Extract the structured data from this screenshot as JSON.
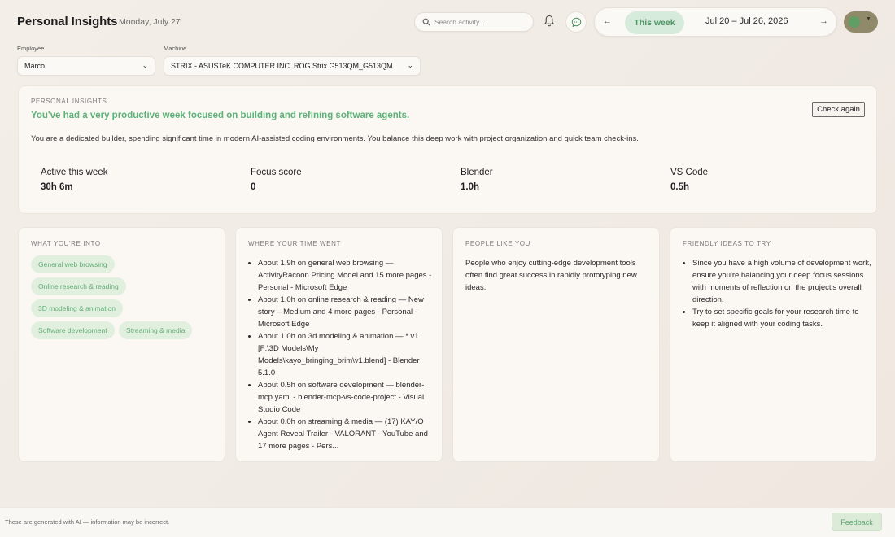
{
  "header": {
    "title": "Personal Insights",
    "date": "Monday, July 27",
    "search_placeholder": "Search activity...",
    "week": {
      "prev": "←",
      "current_label": "This week",
      "range": "Jul 20 – Jul 26, 2026",
      "next": "→"
    }
  },
  "filters": {
    "employee_label": "Employee",
    "employee_value": "Marco",
    "machine_label": "Machine",
    "machine_value": "STRIX - ASUSTeK COMPUTER INC. ROG Strix G513QM_G513QM"
  },
  "insights": {
    "section_label": "PERSONAL INSIGHTS",
    "headline": "You've had a very productive week focused on building and refining software agents.",
    "summary": "You are a dedicated builder, spending significant time in modern AI-assisted coding environments. You balance this deep work with project organization and quick team check-ins.",
    "check_again_label": "Check again",
    "stats": [
      {
        "label": "Active this week",
        "value": "30h 6m"
      },
      {
        "label": "Focus score",
        "value": "0"
      },
      {
        "label": "Blender",
        "value": "1.0h"
      },
      {
        "label": "VS Code",
        "value": "0.5h"
      }
    ]
  },
  "cards": {
    "interests": {
      "title": "WHAT YOU'RE INTO",
      "tags": [
        "General web browsing",
        "Online research & reading",
        "3D modeling & animation",
        "Software development",
        "Streaming & media"
      ]
    },
    "time": {
      "title": "WHERE YOUR TIME WENT",
      "items": [
        "About 1.9h on general web browsing — ActivityRacoon Pricing Model and 15 more pages - Personal - Microsoft Edge",
        "About 1.0h on online research & reading — New story – Medium and 4 more pages - Personal - Microsoft Edge",
        "About 1.0h on 3d modeling & animation — * v1 [F:\\3D Models\\My Models\\kayo_bringing_brim\\v1.blend] - Blender 5.1.0",
        "About 0.5h on software development — blender-mcp.yaml - blender-mcp-vs-code-project - Visual Studio Code",
        "About 0.0h on streaming & media — (17) KAY/O Agent Reveal Trailer - VALORANT - YouTube and 17 more pages - Pers..."
      ]
    },
    "people": {
      "title": "PEOPLE LIKE YOU",
      "body": "People who enjoy cutting-edge development tools often find great success in rapidly prototyping new ideas."
    },
    "ideas": {
      "title": "FRIENDLY IDEAS TO TRY",
      "items": [
        "Since you have a high volume of development work, ensure you're balancing your deep focus sessions with moments of reflection on the project's overall direction.",
        "Try to set specific goals for your research time to keep it aligned with your coding tasks."
      ]
    }
  },
  "footer": {
    "note": "These are generated with AI — information may be incorrect.",
    "feedback_label": "Feedback"
  },
  "colors": {
    "accent_green": "#5cb278",
    "tag_bg": "#e1efdf",
    "background": "#f1ebe4"
  }
}
